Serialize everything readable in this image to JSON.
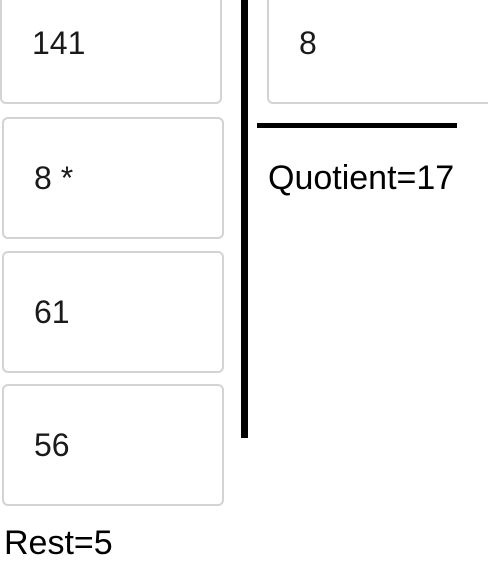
{
  "dividend_column": {
    "fields": [
      {
        "value": "141"
      },
      {
        "value": "8 *"
      },
      {
        "value": "61"
      },
      {
        "value": "56"
      }
    ]
  },
  "divisor": {
    "value": "8"
  },
  "quotient_label": "Quotient=17",
  "rest_label": "Rest=5"
}
